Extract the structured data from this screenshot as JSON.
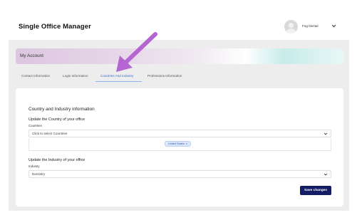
{
  "header": {
    "app_title": "Single Office Manager",
    "user_name": "Fog Dental"
  },
  "banner": {
    "title": "My Account"
  },
  "tabs": [
    {
      "label": "Contact Information",
      "active": false
    },
    {
      "label": "Login Information",
      "active": false
    },
    {
      "label": "Countries And Industry",
      "active": true
    },
    {
      "label": "Professions Information",
      "active": false
    }
  ],
  "form": {
    "section_title": "Country and Industry information",
    "country": {
      "heading": "Update the Country of your office",
      "label": "Countries",
      "placeholder": "Click to select Countries",
      "selected_tags": [
        {
          "label": "United States",
          "remove_glyph": "×"
        }
      ]
    },
    "industry": {
      "heading": "Update the Industry of your office",
      "label": "Industry",
      "value": "Dentistry"
    },
    "save_label": "Save changes"
  },
  "colors": {
    "accent_blue": "#3a6fd8",
    "save_button": "#131d63",
    "annotation_arrow": "#b565d1"
  },
  "icons": {
    "user_menu": "chevron-down-icon",
    "countries_select": "chevron-down-icon",
    "industry_select": "chevron-down-icon",
    "annotation": "arrow-pointer-icon"
  }
}
